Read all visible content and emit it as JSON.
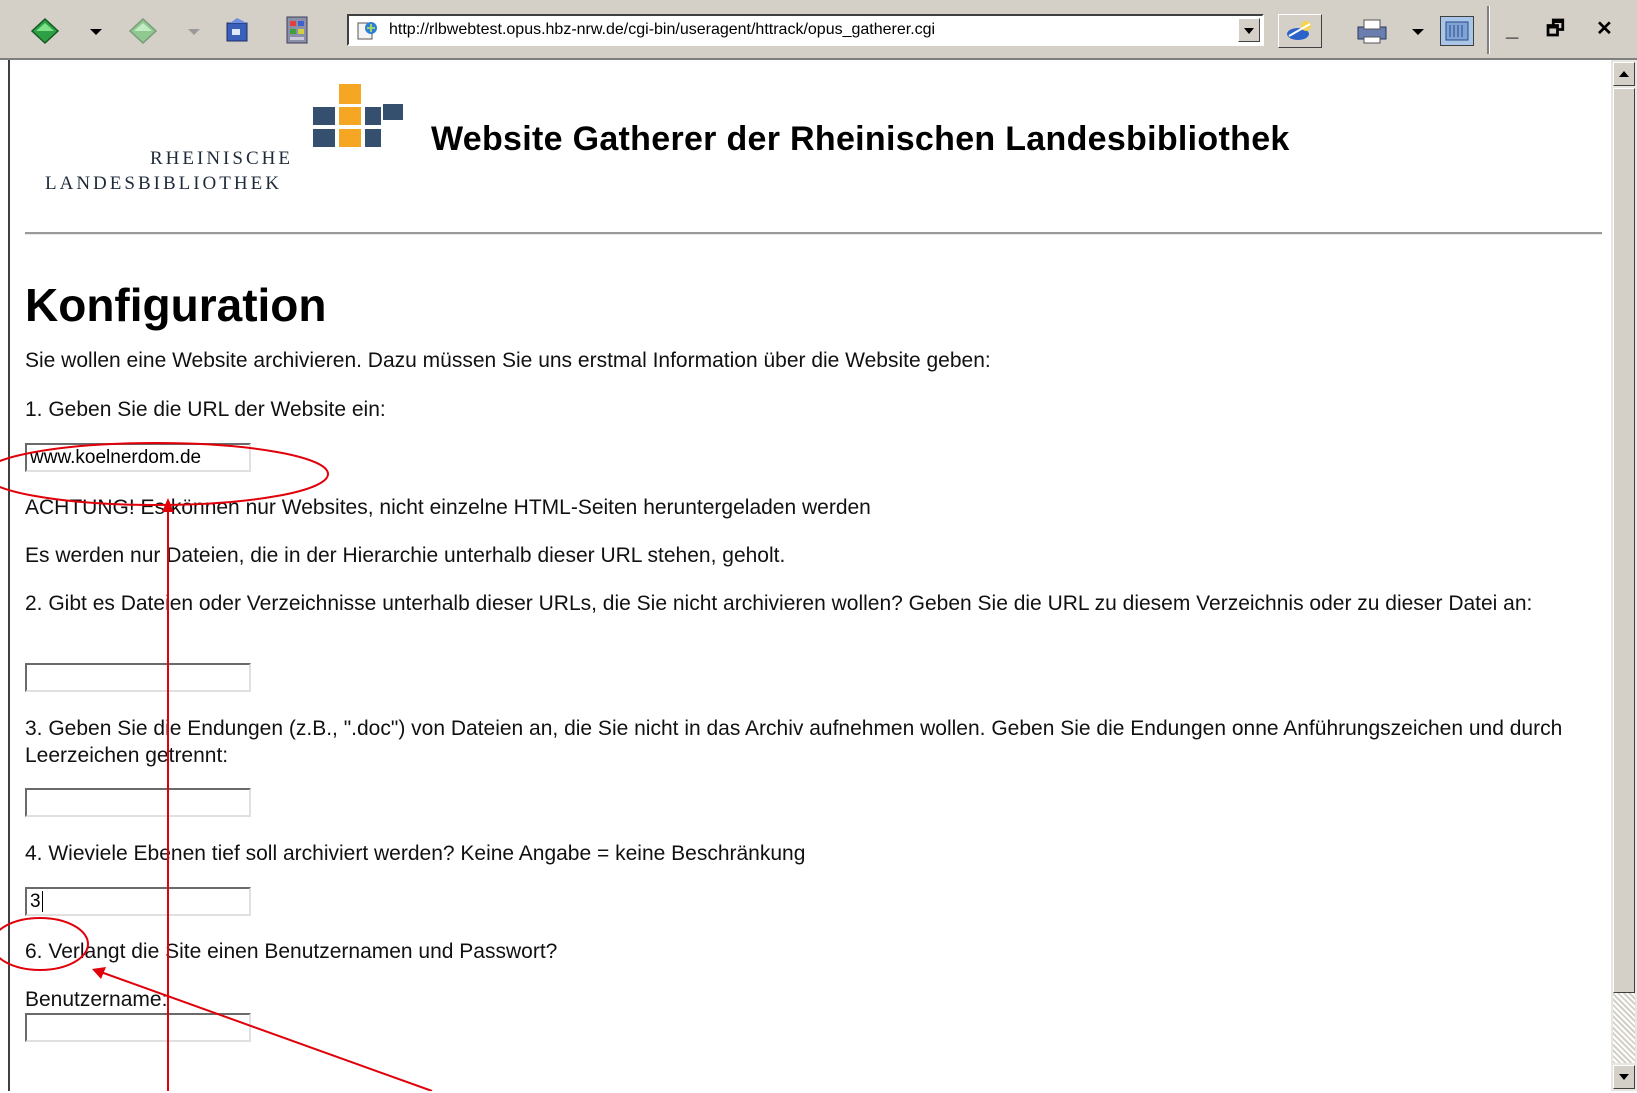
{
  "browser": {
    "address_url": "http://rlbwebtest.opus.hbz-nrw.de/cgi-bin/useragent/httrack/opus_gatherer.cgi",
    "toolbar_icons": [
      "back-icon",
      "forward-icon",
      "home-icon",
      "history-icon",
      "search-icon",
      "print-icon",
      "view-icon"
    ],
    "window_controls": {
      "minimize": "_",
      "restore": "🗗",
      "close": "✕"
    }
  },
  "header": {
    "logo_line1": "RHEINISCHE",
    "logo_line2": "LANDESBIBLIOTHEK",
    "title": "Website Gatherer der Rheinischen Landesbibliothek"
  },
  "main": {
    "heading": "Konfiguration",
    "intro": "Sie wollen eine Website archivieren. Dazu müssen Sie uns erstmal Information über die Website geben:",
    "q1": "1. Geben Sie die URL der Website ein:",
    "url_value": "www.koelnerdom.de",
    "warning": "ACHTUNG! Es können nur Websites, nicht einzelne HTML-Seiten heruntergeladen werden",
    "note": "Es werden nur Dateien, die in der Hierarchie unterhalb dieser URL stehen, geholt.",
    "q2": "2. Gibt es Dateien oder Verzeichnisse unterhalb dieser URLs, die Sie nicht archivieren wollen? Geben Sie die URL zu diesem Verzeichnis oder zu dieser Datei an:",
    "exclude_value": "",
    "q3": "3. Geben Sie die Endungen (z.B., \".doc\") von Dateien an, die Sie nicht in das Archiv aufnehmen wollen. Geben Sie die Endungen onne Anführungszeichen und durch Leerzeichen getrennt:",
    "extensions_value": "",
    "q4": "4. Wieviele Ebenen tief soll archiviert werden? Keine Angabe = keine Beschränkung",
    "depth_value": "3",
    "q6": "6. Verlangt die Site einen Benutzernamen und Passwort?",
    "username_label": "Benutzername:",
    "username_value": ""
  },
  "colors": {
    "annotation": "#e0000a",
    "logo_orange": "#f5a623",
    "logo_navy": "#34506e",
    "toolbar_bg": "#d4d0c8"
  }
}
